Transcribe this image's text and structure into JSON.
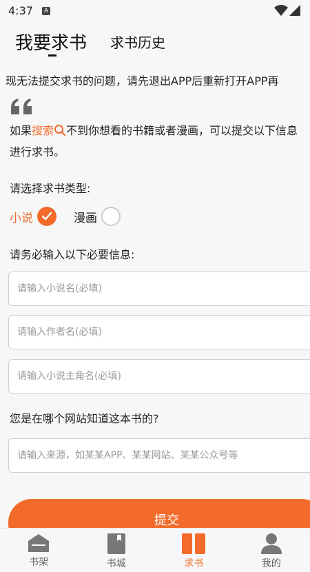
{
  "status_bar": {
    "time": "4:37",
    "notification_icon": "A"
  },
  "tabs": {
    "main": "我要求书",
    "history": "求书历史"
  },
  "notice": "现无法提交求书的问题，请先退出APP后重新打开APP再",
  "intro": {
    "pre": "如果",
    "search": "搜索",
    "post": "不到你想看的书籍或者漫画，可以提交以下信息进行求书。"
  },
  "type_section": {
    "label": "请选择求书类型:",
    "options": [
      {
        "label": "小说",
        "selected": true
      },
      {
        "label": "漫画",
        "selected": false
      }
    ]
  },
  "required_section": {
    "label": "请务必输入以下必要信息:",
    "fields": [
      {
        "placeholder": "请输入小说名(必填)",
        "value": ""
      },
      {
        "placeholder": "请输入作者名(必填)",
        "value": ""
      },
      {
        "placeholder": "请输入小说主角名(必填)",
        "value": ""
      }
    ]
  },
  "source_section": {
    "label": "您是在哪个网站知道这本书的?",
    "placeholder": "请输入来源，如某某APP、某某网站、某某公众号等",
    "value": ""
  },
  "submit_label": "提交",
  "nav": [
    {
      "label": "书架",
      "icon": "bookshelf-icon"
    },
    {
      "label": "书城",
      "icon": "bookstore-icon"
    },
    {
      "label": "求书",
      "icon": "request-book-icon",
      "active": true
    },
    {
      "label": "我的",
      "icon": "profile-icon"
    }
  ],
  "colors": {
    "accent": "#f26b2a",
    "background": "#f7f7f7"
  }
}
